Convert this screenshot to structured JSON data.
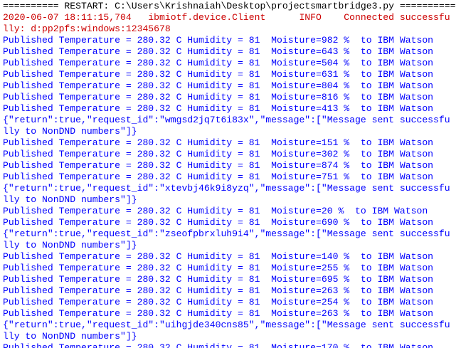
{
  "console": {
    "lines": [
      {
        "kind": "restart",
        "text": "========== RESTART: C:\\Users\\Krishnaiah\\Desktop\\projectsmartbridge3.py =========="
      },
      {
        "kind": "error",
        "text": "2020-06-07 18:11:15,704   ibmiotf.device.Client      INFO    Connected successfu"
      },
      {
        "kind": "error",
        "text": "lly: d:pp2pfs:windows:12345678"
      },
      {
        "kind": "output",
        "text": "Published Temperature = 280.32 C Humidity = 81  Moisture=982 %  to IBM Watson"
      },
      {
        "kind": "output",
        "text": "Published Temperature = 280.32 C Humidity = 81  Moisture=643 %  to IBM Watson"
      },
      {
        "kind": "output",
        "text": "Published Temperature = 280.32 C Humidity = 81  Moisture=504 %  to IBM Watson"
      },
      {
        "kind": "output",
        "text": "Published Temperature = 280.32 C Humidity = 81  Moisture=631 %  to IBM Watson"
      },
      {
        "kind": "output",
        "text": "Published Temperature = 280.32 C Humidity = 81  Moisture=804 %  to IBM Watson"
      },
      {
        "kind": "output",
        "text": "Published Temperature = 280.32 C Humidity = 81  Moisture=816 %  to IBM Watson"
      },
      {
        "kind": "output",
        "text": "Published Temperature = 280.32 C Humidity = 81  Moisture=413 %  to IBM Watson"
      },
      {
        "kind": "output",
        "text": "{\"return\":true,\"request_id\":\"wmgsd2jq7t6i83x\",\"message\":[\"Message sent successfu"
      },
      {
        "kind": "output",
        "text": "lly to NonDND numbers\"]}"
      },
      {
        "kind": "output",
        "text": "Published Temperature = 280.32 C Humidity = 81  Moisture=151 %  to IBM Watson"
      },
      {
        "kind": "output",
        "text": "Published Temperature = 280.32 C Humidity = 81  Moisture=302 %  to IBM Watson"
      },
      {
        "kind": "output",
        "text": "Published Temperature = 280.32 C Humidity = 81  Moisture=874 %  to IBM Watson"
      },
      {
        "kind": "output",
        "text": "Published Temperature = 280.32 C Humidity = 81  Moisture=751 %  to IBM Watson"
      },
      {
        "kind": "output",
        "text": "{\"return\":true,\"request_id\":\"xtevbj46k9i8yzq\",\"message\":[\"Message sent successfu"
      },
      {
        "kind": "output",
        "text": "lly to NonDND numbers\"]}"
      },
      {
        "kind": "output",
        "text": "Published Temperature = 280.32 C Humidity = 81  Moisture=20 %  to IBM Watson"
      },
      {
        "kind": "output",
        "text": "Published Temperature = 280.32 C Humidity = 81  Moisture=690 %  to IBM Watson"
      },
      {
        "kind": "output",
        "text": "{\"return\":true,\"request_id\":\"zseofpbrxluh9i4\",\"message\":[\"Message sent successfu"
      },
      {
        "kind": "output",
        "text": "lly to NonDND numbers\"]}"
      },
      {
        "kind": "output",
        "text": "Published Temperature = 280.32 C Humidity = 81  Moisture=140 %  to IBM Watson"
      },
      {
        "kind": "output",
        "text": "Published Temperature = 280.32 C Humidity = 81  Moisture=255 %  to IBM Watson"
      },
      {
        "kind": "output",
        "text": "Published Temperature = 280.32 C Humidity = 81  Moisture=695 %  to IBM Watson"
      },
      {
        "kind": "output",
        "text": "Published Temperature = 280.32 C Humidity = 81  Moisture=263 %  to IBM Watson"
      },
      {
        "kind": "output",
        "text": "Published Temperature = 280.32 C Humidity = 81  Moisture=254 %  to IBM Watson"
      },
      {
        "kind": "output",
        "text": "Published Temperature = 280.32 C Humidity = 81  Moisture=263 %  to IBM Watson"
      },
      {
        "kind": "output",
        "text": "{\"return\":true,\"request_id\":\"uihgjde340cns85\",\"message\":[\"Message sent successfu"
      },
      {
        "kind": "output",
        "text": "lly to NonDND numbers\"]}"
      },
      {
        "kind": "output",
        "text": "Published Temperature = 280.32 C Humidity = 81  Moisture=170 %  to IBM Watson"
      }
    ]
  }
}
